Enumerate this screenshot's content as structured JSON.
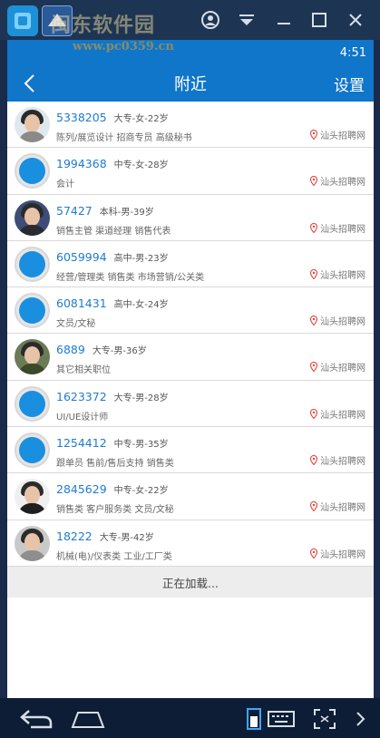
{
  "watermark": {
    "text": "闽东软件园",
    "url": "www.pc0359.cn"
  },
  "status": {
    "time": "4:51"
  },
  "header": {
    "title": "附近",
    "settings_label": "设置"
  },
  "items": [
    {
      "id": "5338205",
      "meta": "大专-女-22岁",
      "tags": "陈列/展览设计 招商专员 高级秘书",
      "source": "汕头招聘网"
    },
    {
      "id": "1994368",
      "meta": "中专-女-28岁",
      "tags": "会计",
      "source": "汕头招聘网"
    },
    {
      "id": "57427",
      "meta": "本科-男-39岁",
      "tags": "销售主管 渠道经理 销售代表",
      "source": "汕头招聘网"
    },
    {
      "id": "6059994",
      "meta": "高中-男-23岁",
      "tags": "经营/管理类 销售类 市场营销/公关类",
      "source": "汕头招聘网"
    },
    {
      "id": "6081431",
      "meta": "高中-女-24岁",
      "tags": "文员/文秘",
      "source": "汕头招聘网"
    },
    {
      "id": "6889",
      "meta": "大专-男-36岁",
      "tags": "其它相关职位",
      "source": "汕头招聘网"
    },
    {
      "id": "1623372",
      "meta": "大专-男-28岁",
      "tags": "UI/UE设计师",
      "source": "汕头招聘网"
    },
    {
      "id": "1254412",
      "meta": "中专-男-35岁",
      "tags": "跟单员 售前/售后支持 销售类",
      "source": "汕头招聘网"
    },
    {
      "id": "2845629",
      "meta": "中专-女-22岁",
      "tags": "销售类 客户服务类 文员/文秘",
      "source": "汕头招聘网"
    },
    {
      "id": "18222",
      "meta": "大专-男-42岁",
      "tags": "机械(电)/仪表类 工业/工厂类",
      "source": "汕头招聘网"
    }
  ],
  "loading_text": "正在加载...",
  "colors": {
    "primary": "#0f76c9",
    "link": "#1f7bd0",
    "avatar_default": "#1a8fe0",
    "pin": "#e0473c"
  }
}
